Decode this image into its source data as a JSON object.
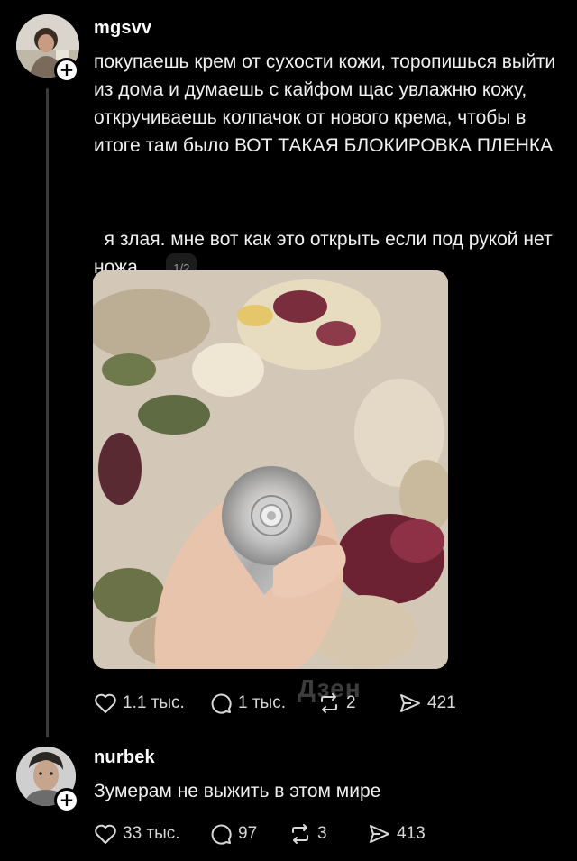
{
  "post": {
    "username": "mgsvv",
    "text_main": "покупаешь крем от сухости кожи, торопишься выйти из дома и думаешь с кайфом щас увлажню кожу, откручиваешь колпачок от нового крема, чтобы в итоге там было ВОТ ТАКАЯ БЛОКИРОВКА ПЛЕНКА",
    "text_second": "я злая. мне вот как это открыть если под рукой нет ножа...",
    "image_counter": "1/2",
    "likes": "1.1 тыс.",
    "replies": "1 тыс.",
    "reposts": "2",
    "shares": "421",
    "watermark": "Дзен"
  },
  "reply": {
    "username": "nurbek",
    "text": "Зумерам не выжить в этом мире",
    "likes": "33 тыс.",
    "replies": "97",
    "reposts": "3",
    "shares": "413"
  },
  "icons": {
    "like": "heart-icon",
    "reply": "comment-icon",
    "repost": "repost-icon",
    "share": "send-icon",
    "follow": "plus-icon"
  },
  "colors": {
    "background": "#000000",
    "text": "#f1f1f1",
    "secondary": "#9a9a9a",
    "thread_line": "#3a3a3a"
  }
}
